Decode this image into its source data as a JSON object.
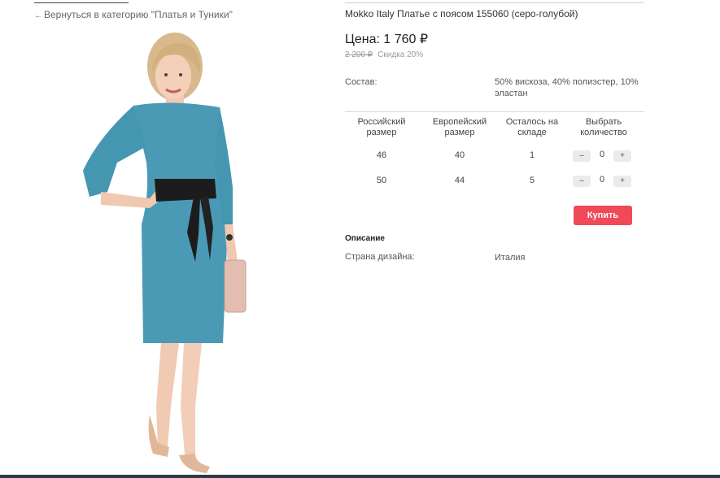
{
  "back_link": {
    "arrow": "←",
    "label": "Вернуться в категорию \"Платья и Туники\""
  },
  "product": {
    "title": "Mokko Italy Платье с поясом 155060 (серо-голубой)",
    "price": "Цена: 1 760 ₽",
    "old_price": "2 200 ₽",
    "discount": "Скидка 20%",
    "composition_label": "Состав:",
    "composition_value": "50% вискоза, 40% полиэстер, 10% эластан"
  },
  "sizes_table": {
    "headers": [
      "Российский размер",
      "Европейский размер",
      "Осталось на складе",
      "Выбрать количество"
    ],
    "rows": [
      {
        "ru": "46",
        "eu": "40",
        "stock": "1",
        "qty": "0"
      },
      {
        "ru": "50",
        "eu": "44",
        "stock": "5",
        "qty": "0"
      }
    ],
    "minus_label": "–",
    "plus_label": "+"
  },
  "buy_label": "Купить",
  "description": {
    "heading": "Описание",
    "country_label": "Страна дизайна:",
    "country_value": "Италия"
  },
  "colors": {
    "accent": "#f04a58",
    "dress": "#4a9ab5",
    "belt": "#1c1c1c",
    "bottom_bar": "#2e3a48"
  }
}
